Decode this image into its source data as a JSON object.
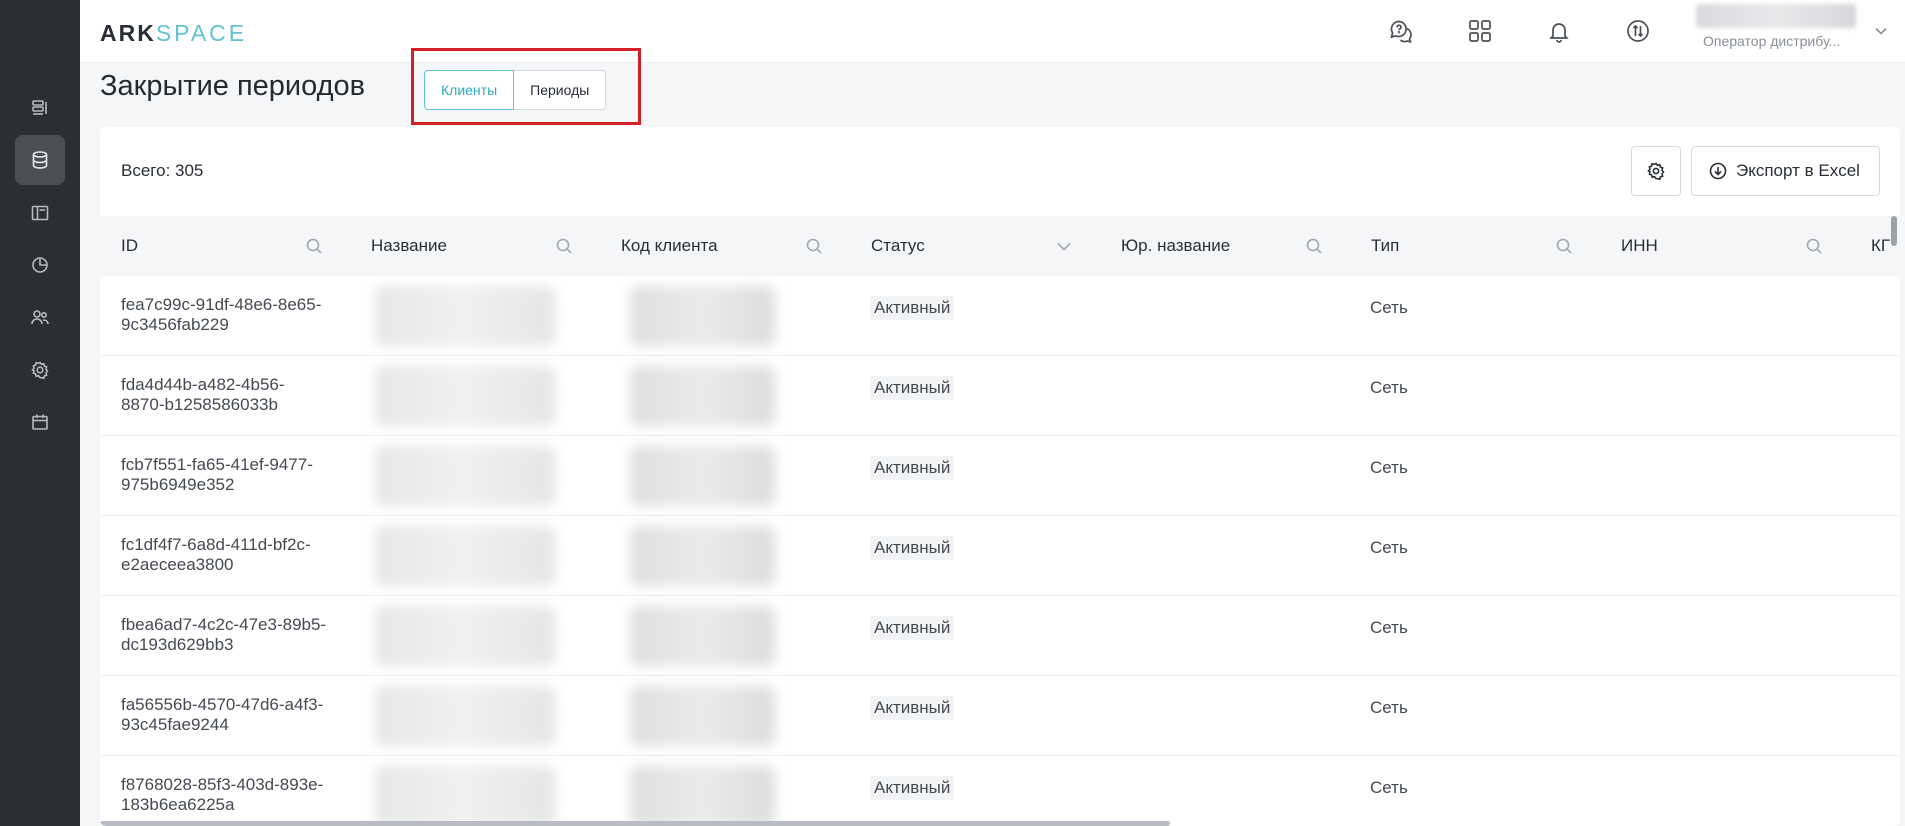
{
  "header": {
    "logo_ark": "ARK",
    "logo_space": "SPACE",
    "user_role": "Оператор дистрибу..."
  },
  "sidebar": {
    "items": [
      {
        "icon": "list-layout-icon"
      },
      {
        "icon": "database-icon",
        "active": true
      },
      {
        "icon": "panel-icon"
      },
      {
        "icon": "pie-chart-icon"
      },
      {
        "icon": "users-icon"
      },
      {
        "icon": "gear-icon"
      },
      {
        "icon": "calendar-icon"
      }
    ]
  },
  "page": {
    "title": "Закрытие периодов",
    "tabs": [
      {
        "label": "Клиенты",
        "active": true
      },
      {
        "label": "Периоды",
        "active": false
      }
    ]
  },
  "toolbar": {
    "total": "Всего: 305",
    "export_label": "Экспорт в Excel"
  },
  "table": {
    "columns": [
      "ID",
      "Название",
      "Код клиента",
      "Статус",
      "Юр. название",
      "Тип",
      "ИНН",
      "КГ"
    ],
    "rows": [
      {
        "id_line1": "fea7c99c-91df-48e6-8e65-",
        "id_line2": "9c3456fab229",
        "status": "Активный",
        "type": "Сеть"
      },
      {
        "id_line1": "fda4d44b-a482-4b56-",
        "id_line2": "8870-b1258586033b",
        "status": "Активный",
        "type": "Сеть"
      },
      {
        "id_line1": "fcb7f551-fa65-41ef-9477-",
        "id_line2": "975b6949e352",
        "status": "Активный",
        "type": "Сеть"
      },
      {
        "id_line1": "fc1df4f7-6a8d-411d-bf2c-",
        "id_line2": "e2aeceea3800",
        "status": "Активный",
        "type": "Сеть"
      },
      {
        "id_line1": "fbea6ad7-4c2c-47e3-89b5-",
        "id_line2": "dc193d629bb3",
        "status": "Активный",
        "type": "Сеть"
      },
      {
        "id_line1": "fa56556b-4570-47d6-a4f3-",
        "id_line2": "93c45fae9244",
        "status": "Активный",
        "type": "Сеть"
      },
      {
        "id_line1": "f8768028-85f3-403d-893e-",
        "id_line2": "183b6ea6225a",
        "status": "Активный",
        "type": "Сеть"
      }
    ]
  },
  "colors": {
    "accent": "#5fc3d2",
    "sidebar_bg": "#2b2e35",
    "highlight_frame": "#d31f26"
  }
}
